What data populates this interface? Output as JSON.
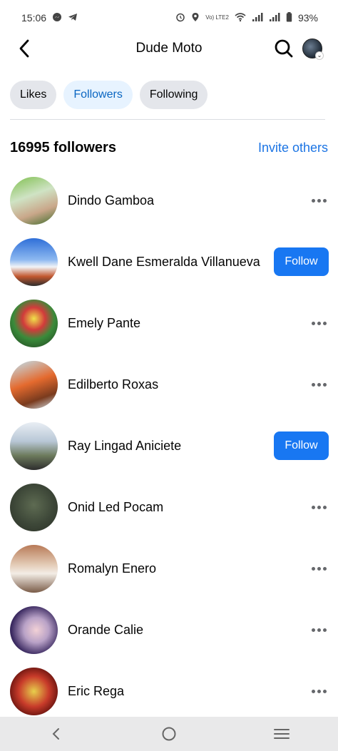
{
  "status_bar": {
    "time": "15:06",
    "network_text": "Vo) LTE2",
    "battery": "93%"
  },
  "header": {
    "title": "Dude Moto",
    "back_icon": "chevron-left-icon",
    "search_icon": "search-icon"
  },
  "tabs": [
    {
      "label": "Likes",
      "active": false
    },
    {
      "label": "Followers",
      "active": true
    },
    {
      "label": "Following",
      "active": false
    }
  ],
  "count_row": {
    "count_text": "16995 followers",
    "invite_label": "Invite others"
  },
  "followers": [
    {
      "name": "Dindo Gamboa",
      "action": "more"
    },
    {
      "name": "Kwell Dane Esmeralda Villanueva",
      "action": "follow",
      "follow_label": "Follow"
    },
    {
      "name": "Emely Pante",
      "action": "more"
    },
    {
      "name": "Edilberto Roxas",
      "action": "more"
    },
    {
      "name": "Ray Lingad Aniciete",
      "action": "follow",
      "follow_label": "Follow"
    },
    {
      "name": "Onid Led Pocam",
      "action": "more"
    },
    {
      "name": "Romalyn Enero",
      "action": "more"
    },
    {
      "name": "Orande Calie",
      "action": "more"
    },
    {
      "name": "Eric Rega",
      "action": "more"
    }
  ],
  "colors": {
    "accent": "#1877f2",
    "link": "#1b74e4",
    "active_tab_bg": "#e7f3ff",
    "tab_bg": "#e4e6eb"
  }
}
